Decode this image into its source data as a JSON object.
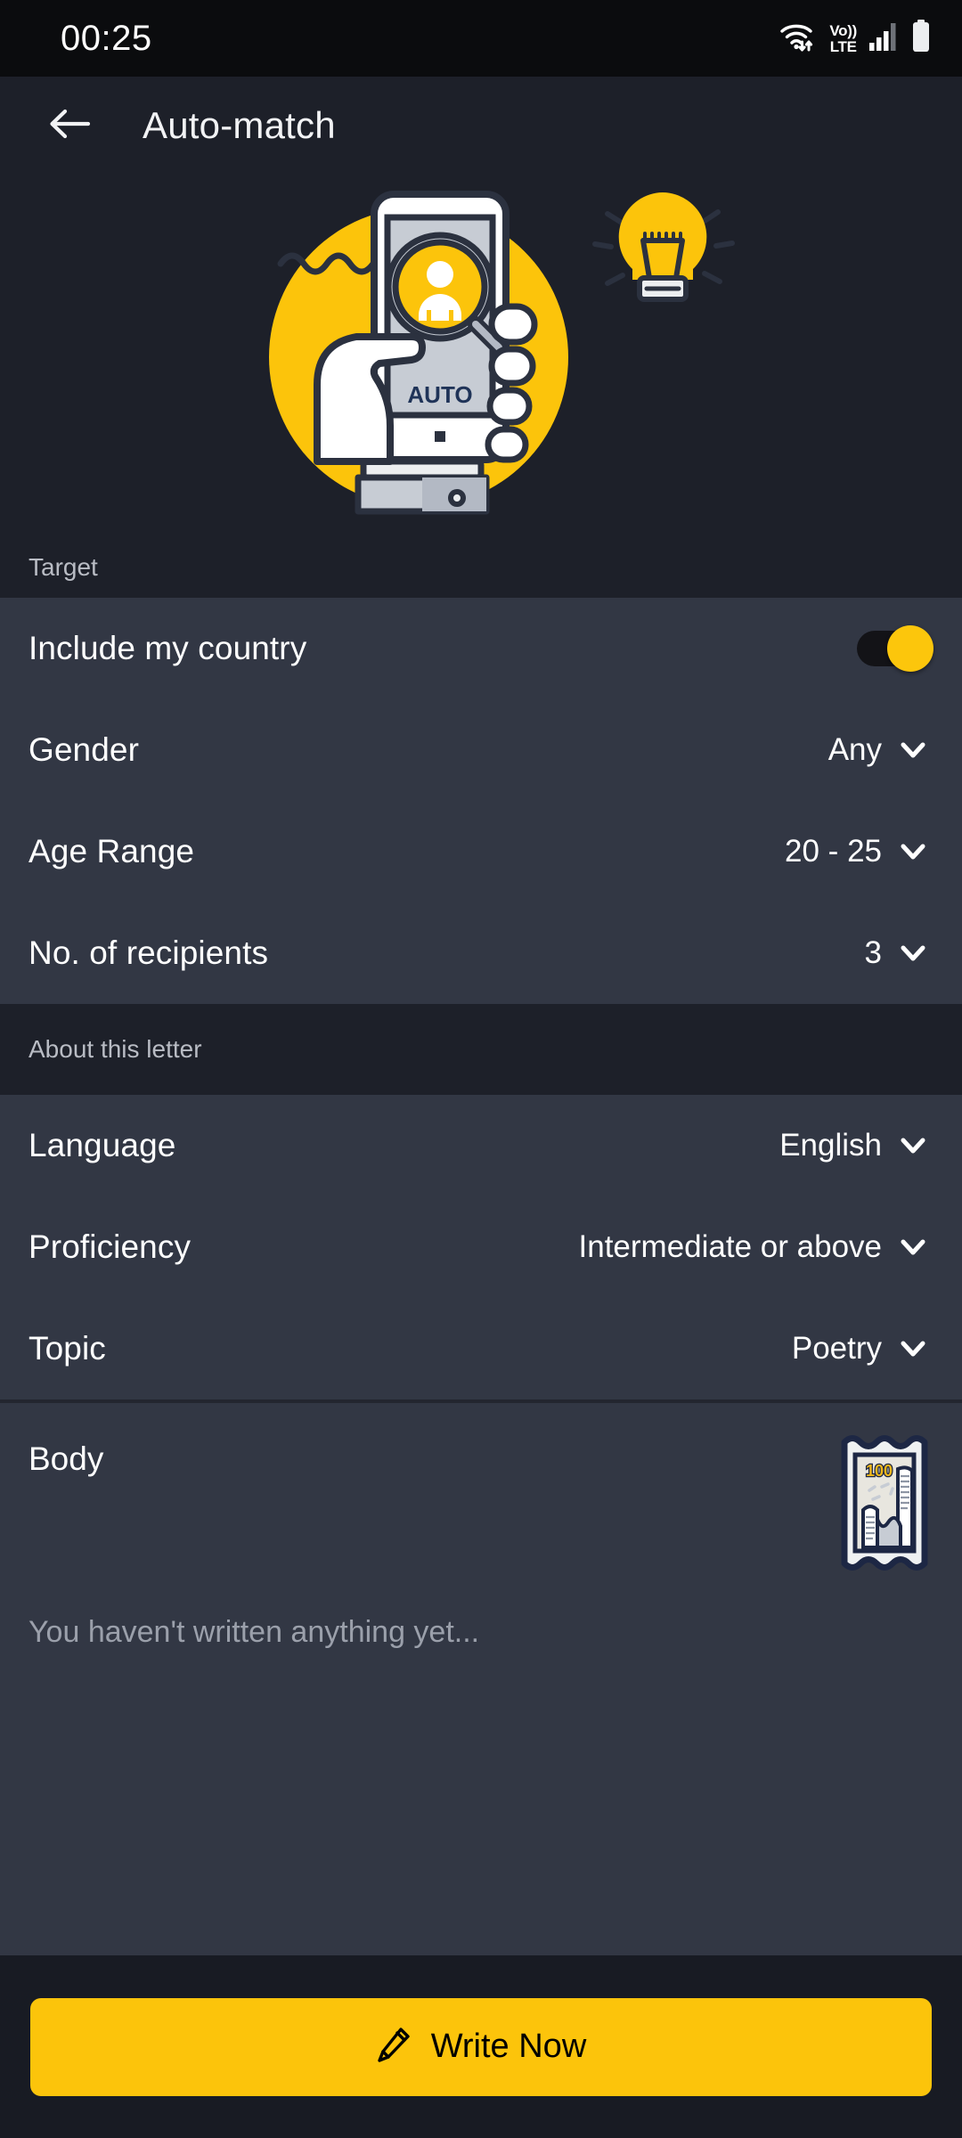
{
  "status_bar": {
    "clock": "00:25",
    "wifi_icon": "wifi-icon",
    "volte_top": "Vo))",
    "volte_bottom": "LTE",
    "signal_icon": "signal-bars-icon",
    "battery_icon": "battery-full-icon"
  },
  "app_bar": {
    "back_icon": "back-arrow-icon",
    "title": "Auto-match"
  },
  "hero": {
    "illustration_name": "auto-match-illustration",
    "phone_screen_label": "AUTO",
    "bulb_icon": "lightbulb-icon",
    "magnifier_icon": "magnifier-person-icon"
  },
  "sections": [
    {
      "header": "Target",
      "rows": [
        {
          "label": "Include my country",
          "type": "toggle",
          "value": "on"
        },
        {
          "label": "Gender",
          "type": "select",
          "value": "Any"
        },
        {
          "label": "Age Range",
          "type": "select",
          "value": "20 - 25"
        },
        {
          "label": "No. of recipients",
          "type": "select",
          "value": "3"
        }
      ]
    },
    {
      "header": "About this letter",
      "rows": [
        {
          "label": "Language",
          "type": "select",
          "value": "English"
        },
        {
          "label": "Proficiency",
          "type": "select",
          "value": "Intermediate or above"
        },
        {
          "label": "Topic",
          "type": "select",
          "value": "Poetry"
        }
      ]
    }
  ],
  "body": {
    "title": "Body",
    "stamp_icon": "postage-stamp-icon",
    "stamp_value": "100",
    "placeholder": "You haven't written anything yet..."
  },
  "bottom_bar": {
    "write_icon": "pencil-icon",
    "write_label": "Write Now"
  },
  "colors": {
    "accent_yellow": "#fcc40b",
    "page_background": "#1d2029",
    "card_background": "#323744",
    "bottom_bar_background": "#181b23",
    "status_bar_background": "#0b0c0e",
    "primary_text": "#ffffff",
    "muted_text": "#9ba0ab",
    "illustration_ink": "#2b313f"
  }
}
